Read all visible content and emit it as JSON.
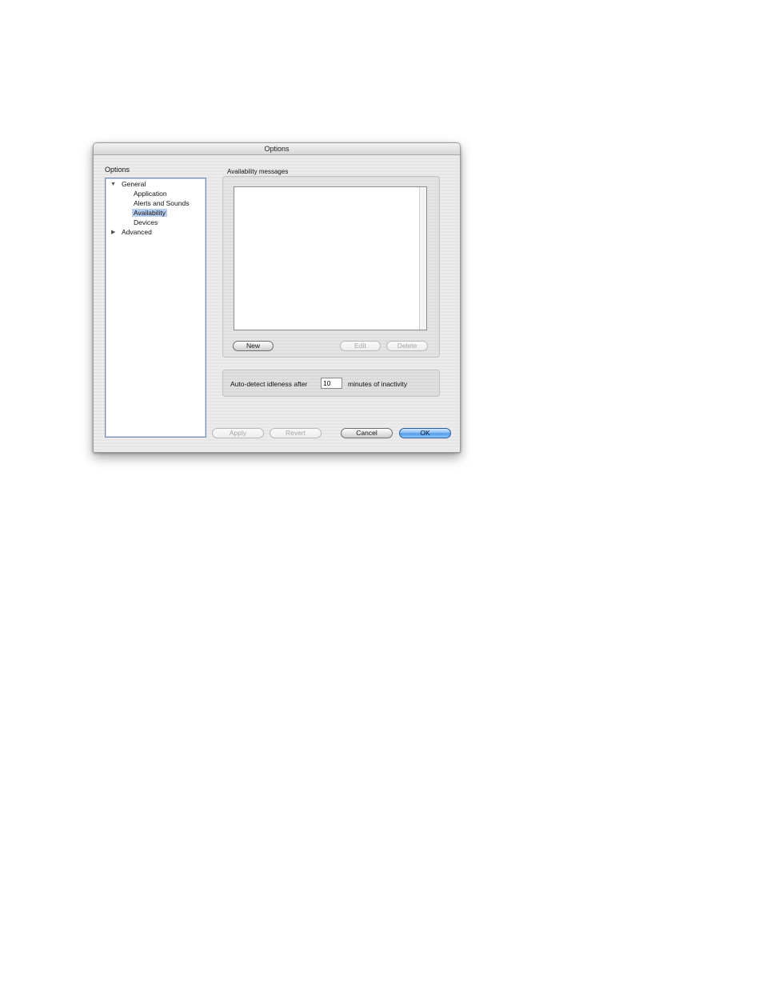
{
  "window": {
    "title": "Options"
  },
  "sidebar": {
    "label": "Options",
    "tree": [
      {
        "label": "General",
        "expanded": true
      },
      {
        "label": "Application"
      },
      {
        "label": "Alerts and Sounds"
      },
      {
        "label": "Availability",
        "selected": true
      },
      {
        "label": "Devices"
      },
      {
        "label": "Advanced",
        "expanded": false
      }
    ]
  },
  "availability": {
    "group_label": "Availability messages",
    "messages": [],
    "new_label": "New",
    "edit_label": "Edit",
    "delete_label": "Delete"
  },
  "idle": {
    "prefix": "Auto-detect idleness after",
    "minutes": "10",
    "suffix": "minutes of inactivity"
  },
  "footer": {
    "apply_label": "Apply",
    "revert_label": "Revert",
    "cancel_label": "Cancel",
    "ok_label": "OK"
  },
  "colors": {
    "selection": "#b5cdef",
    "default_button": "#5aa2ea"
  }
}
